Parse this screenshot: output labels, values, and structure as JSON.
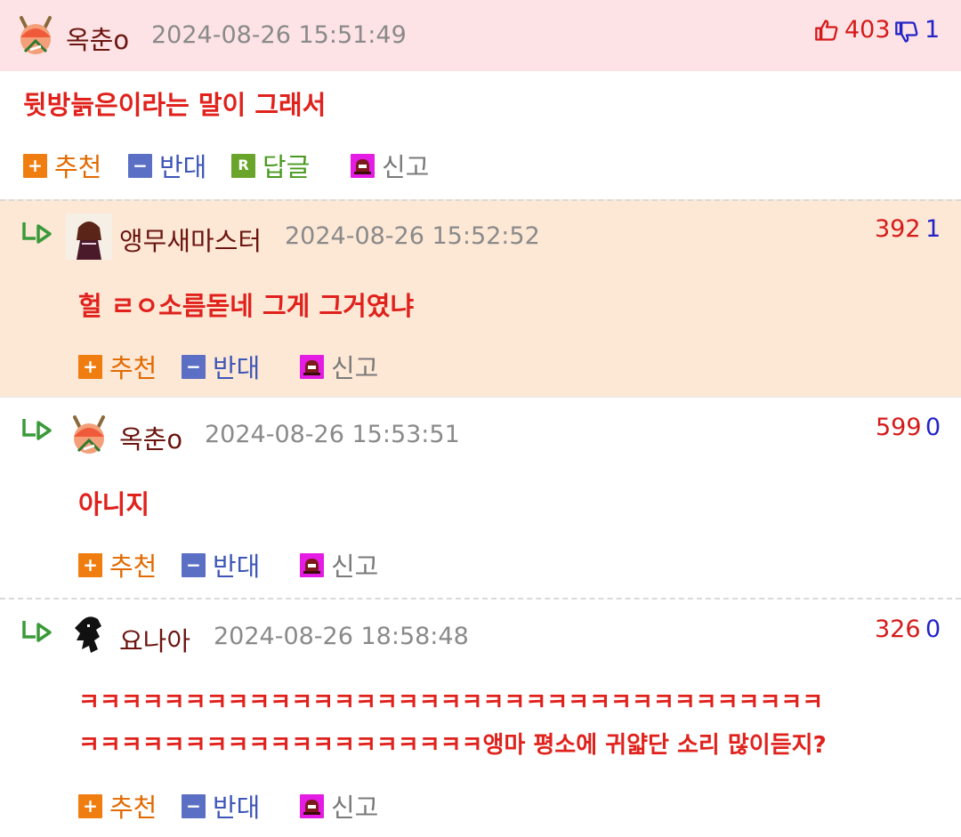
{
  "comments": [
    {
      "nickname": "옥춘o",
      "date": "2024-08-26 15:51:49",
      "up": "403",
      "down": "1",
      "text": [
        "뒷방늙은이라는 말이 그래서"
      ],
      "buttons": {
        "recommend": "추천",
        "oppose": "반대",
        "reply": "답글",
        "reply_badge": "R",
        "report": "신고"
      }
    },
    {
      "nickname": "앵무새마스터",
      "date": "2024-08-26 15:52:52",
      "up": "392",
      "down": "1",
      "text": [
        "헐 ㄹㅇ소름돋네 그게 그거였냐"
      ],
      "buttons": {
        "recommend": "추천",
        "oppose": "반대",
        "report": "신고"
      }
    },
    {
      "nickname": "옥춘o",
      "date": "2024-08-26 15:53:51",
      "up": "599",
      "down": "0",
      "text": [
        "아니지"
      ],
      "buttons": {
        "recommend": "추천",
        "oppose": "반대",
        "report": "신고"
      }
    },
    {
      "nickname": "요나아",
      "date": "2024-08-26 18:58:48",
      "up": "326",
      "down": "0",
      "text": [
        "ㅋㅋㅋㅋㅋㅋㅋㅋㅋㅋㅋㅋㅋㅋㅋㅋㅋㅋㅋㅋㅋㅋㅋㅋㅋㅋㅋㅋㅋㅋㅋㅋㅋㅋㅋ",
        "ㅋㅋㅋㅋㅋㅋㅋㅋㅋㅋㅋㅋㅋㅋㅋㅋㅋㅋㅋ앵마 평소에 귀얇단 소리 많이듣지?"
      ],
      "buttons": {
        "recommend": "추천",
        "oppose": "반대",
        "report": "신고"
      }
    }
  ],
  "colors": {
    "header_bg": "#fde3e5",
    "reply_highlight_bg": "#fde8d6",
    "nickname": "#6b1510",
    "body_text": "#e0211c",
    "upvote": "#d61a1a",
    "downvote": "#2323c8"
  }
}
